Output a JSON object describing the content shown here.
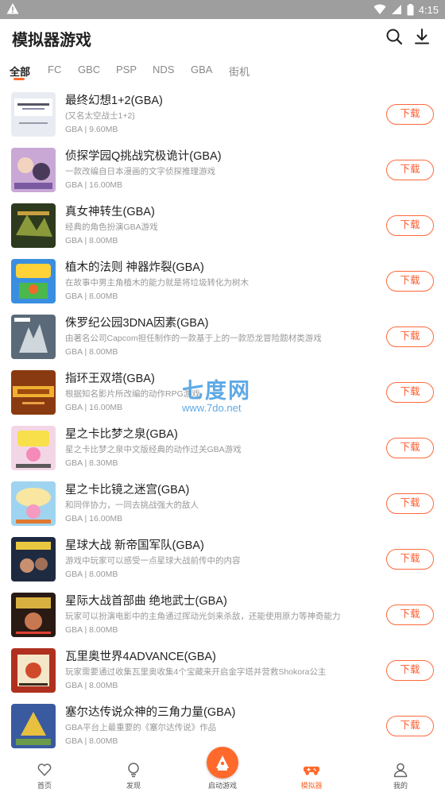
{
  "status_bar": {
    "time": "4:15"
  },
  "header": {
    "title": "模拟器游戏"
  },
  "tabs": [
    {
      "label": "全部",
      "active": true
    },
    {
      "label": "FC"
    },
    {
      "label": "GBC"
    },
    {
      "label": "PSP"
    },
    {
      "label": "NDS"
    },
    {
      "label": "GBA"
    },
    {
      "label": "街机"
    }
  ],
  "download_label": "下载",
  "games": [
    {
      "title": "最终幻想1+2(GBA)",
      "desc": "(又名太空战士1+2)",
      "meta": "GBA | 9.60MB",
      "thumb_color": "#e8ecf2"
    },
    {
      "title": "侦探学园Q挑战究极诡计(GBA)",
      "desc": "一款改编自日本漫画的文字侦探推理游戏",
      "meta": "GBA | 16.00MB",
      "thumb_color": "#c9a8d6"
    },
    {
      "title": "真女神转生(GBA)",
      "desc": "经典的角色扮演GBA游戏",
      "meta": "GBA | 8.00MB",
      "thumb_color": "#2e3a1e"
    },
    {
      "title": "植木的法则 神器炸裂(GBA)",
      "desc": "在故事中男主角植木的能力就是将垃圾转化为树木",
      "meta": "GBA | 8.00MB",
      "thumb_color": "#3a8ee0"
    },
    {
      "title": "侏罗纪公园3DNA因素(GBA)",
      "desc": "由著名公司Capcom担任制作的一款基于上的一款恐龙冒险题材类游戏",
      "meta": "GBA | 8.00MB",
      "thumb_color": "#5a6a78"
    },
    {
      "title": "指环王双塔(GBA)",
      "desc": "根据知名影片所改编的动作RPG游戏",
      "meta": "GBA | 16.00MB",
      "thumb_color": "#8a3a10"
    },
    {
      "title": "星之卡比梦之泉(GBA)",
      "desc": "星之卡比梦之泉中文版经典的动作过关GBA游戏",
      "meta": "GBA | 8.30MB",
      "thumb_color": "#f3d6e6"
    },
    {
      "title": "星之卡比镜之迷宫(GBA)",
      "desc": "和同伴协力，一同去挑战强大的敌人",
      "meta": "GBA | 16.00MB",
      "thumb_color": "#9fd4f0"
    },
    {
      "title": "星球大战 新帝国军队(GBA)",
      "desc": "游戏中玩家可以感受一点星球大战前传中的内容",
      "meta": "GBA | 8.00MB",
      "thumb_color": "#1e2a40"
    },
    {
      "title": "星际大战首部曲 绝地武士(GBA)",
      "desc": "玩家可以扮演电影中的主角通过挥动光剑来杀敌，还能使用原力等神奇能力",
      "meta": "GBA | 8.00MB",
      "thumb_color": "#2a1a14"
    },
    {
      "title": "瓦里奥世界4ADVANCE(GBA)",
      "desc": "玩家需要通过收集瓦里奥收集4个宝藏来开启金字塔并营救Shokora公主",
      "meta": "GBA | 8.00MB",
      "thumb_color": "#b03020"
    },
    {
      "title": "塞尔达传说众神的三角力量(GBA)",
      "desc": "GBA平台上最重要的《塞尔达传说》作品",
      "meta": "GBA | 8.00MB",
      "thumb_color": "#3a5aa0"
    }
  ],
  "watermark": {
    "line1": "七度网",
    "line2": "www.7do.net"
  },
  "bottom_nav": [
    {
      "label": "首页",
      "icon": "heart-icon"
    },
    {
      "label": "发现",
      "icon": "lightbulb-icon"
    },
    {
      "label": "启动游戏",
      "icon": "launch-icon"
    },
    {
      "label": "模拟器",
      "icon": "gamepad-icon",
      "active": true
    },
    {
      "label": "我的",
      "icon": "user-icon"
    }
  ],
  "colors": {
    "accent": "#ff6a2c",
    "status_bar": "#9e9e9e"
  }
}
